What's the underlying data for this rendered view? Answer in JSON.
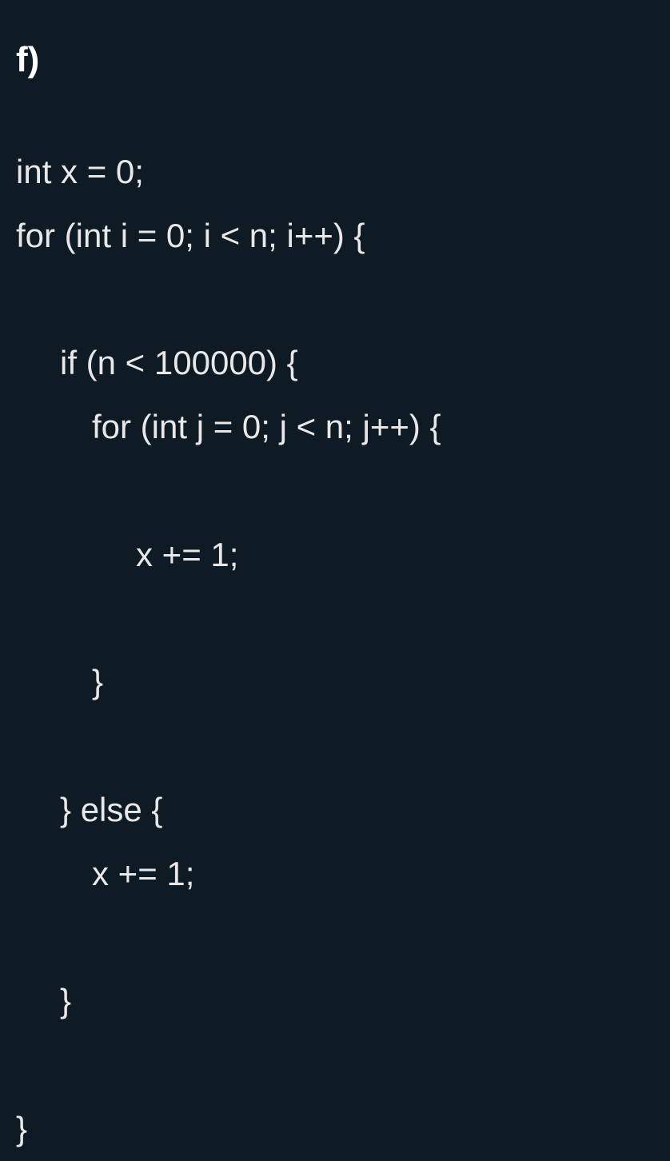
{
  "heading": "f)",
  "lines": {
    "l1": "int x = 0;",
    "l2": "for (int i = 0; i < n; i++) {",
    "l3": "",
    "l4": "if (n < 100000) {",
    "l5": "for (int j = 0; j < n; j++) {",
    "l6": "",
    "l7": "x += 1;",
    "l8": "",
    "l9": "}",
    "l10": "",
    "l11": "} else {",
    "l12": "x += 1;",
    "l13": "",
    "l14": "}",
    "l15": "",
    "l16": "}"
  }
}
